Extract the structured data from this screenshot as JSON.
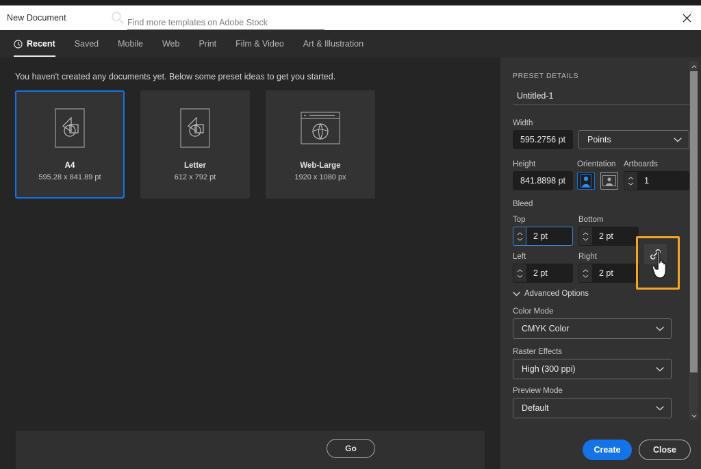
{
  "window": {
    "title": "New Document",
    "close_icon": "close-icon"
  },
  "tabs": [
    {
      "label": "Recent",
      "icon": "clock-icon",
      "active": true
    },
    {
      "label": "Saved",
      "active": false
    },
    {
      "label": "Mobile",
      "active": false
    },
    {
      "label": "Web",
      "active": false
    },
    {
      "label": "Print",
      "active": false
    },
    {
      "label": "Film & Video",
      "active": false
    },
    {
      "label": "Art & Illustration",
      "active": false
    }
  ],
  "content": {
    "intro": "You haven't created any documents yet. Below some preset ideas to get you started.",
    "presets": [
      {
        "name": "A4",
        "size": "595.28 x 841.89 pt",
        "icon": "artboard-page-icon",
        "selected": true
      },
      {
        "name": "Letter",
        "size": "612 x 792 pt",
        "icon": "artboard-page-icon",
        "selected": false
      },
      {
        "name": "Web-Large",
        "size": "1920 x 1080 px",
        "icon": "artboard-web-icon",
        "selected": false
      }
    ]
  },
  "stock": {
    "search_icon": "search-icon",
    "placeholder": "Find more templates on Adobe Stock",
    "value": "",
    "go_label": "Go"
  },
  "panel": {
    "heading": "PRESET DETAILS",
    "document_name": "Untitled-1",
    "width": {
      "label": "Width",
      "value": "595.2756 pt"
    },
    "units": {
      "value": "Points"
    },
    "height": {
      "label": "Height",
      "value": "841.8898 pt"
    },
    "orientation": {
      "label": "Orientation",
      "portrait_icon": "orientation-portrait-icon",
      "landscape_icon": "orientation-landscape-icon",
      "selected": "portrait"
    },
    "artboards": {
      "label": "Artboards",
      "value": "1"
    },
    "bleed": {
      "label": "Bleed",
      "top": {
        "label": "Top",
        "value": "2 pt",
        "focused": true
      },
      "bottom": {
        "label": "Bottom",
        "value": "2 pt"
      },
      "left": {
        "label": "Left",
        "value": "2 pt"
      },
      "right": {
        "label": "Right",
        "value": "2 pt"
      },
      "link_icon": "link-chain-icon",
      "link_highlight_color": "#f5a623"
    },
    "advanced_options": {
      "label": "Advanced Options",
      "icon": "chevron-down-icon",
      "expanded": true
    },
    "color_mode": {
      "label": "Color Mode",
      "value": "CMYK Color"
    },
    "raster_effects": {
      "label": "Raster Effects",
      "value": "High (300 ppi)"
    },
    "preview_mode": {
      "label": "Preview Mode",
      "value": "Default"
    }
  },
  "footer": {
    "create_label": "Create",
    "close_label": "Close"
  },
  "colors": {
    "accent_blue": "#1473e6",
    "highlight_orange": "#f5a623",
    "panel_bg": "#323232",
    "content_bg": "#252525"
  }
}
